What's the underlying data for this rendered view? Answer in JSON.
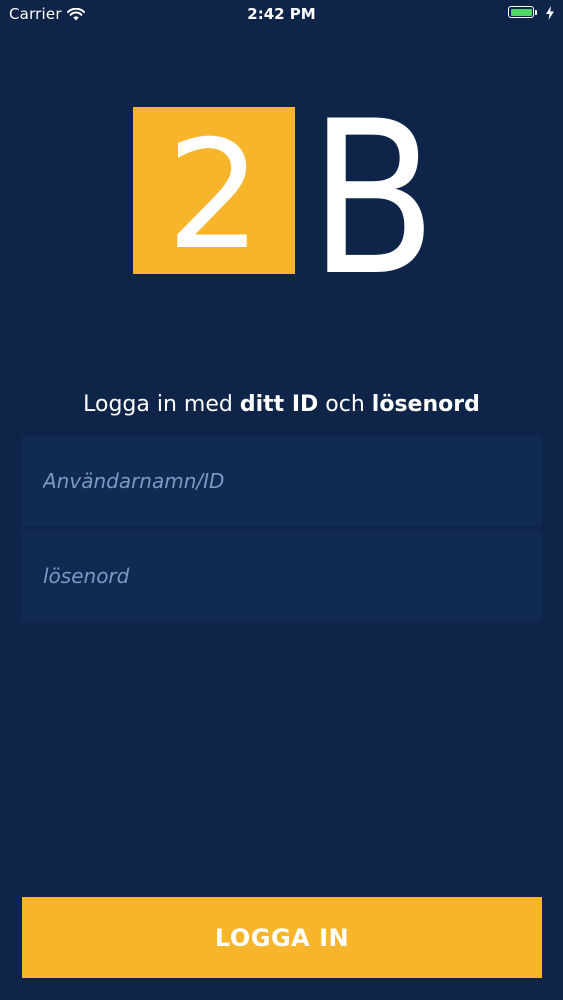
{
  "status_bar": {
    "carrier": "Carrier",
    "time": "2:42 PM",
    "battery_level": 1.0,
    "icons": [
      "wifi-icon",
      "battery-icon",
      "charging-icon"
    ]
  },
  "logo": {
    "text_left": "2",
    "text_right": "B",
    "colors": {
      "square": "#f7b52b",
      "glyph": "#ffffff"
    }
  },
  "login": {
    "headline_prefix": "Logga in med ",
    "headline_bold_1": "ditt ID",
    "headline_middle": " och ",
    "headline_bold_2": "lösenord",
    "username_placeholder": "Användarnamn/ID",
    "username_value": "",
    "password_placeholder": "lösenord",
    "password_value": "",
    "submit_label": "LOGGA IN"
  },
  "colors": {
    "background": "#0e2449",
    "field_background": "#102a52",
    "accent": "#f7b52b",
    "placeholder": "#8098c0",
    "battery_fill": "#4cd964"
  }
}
